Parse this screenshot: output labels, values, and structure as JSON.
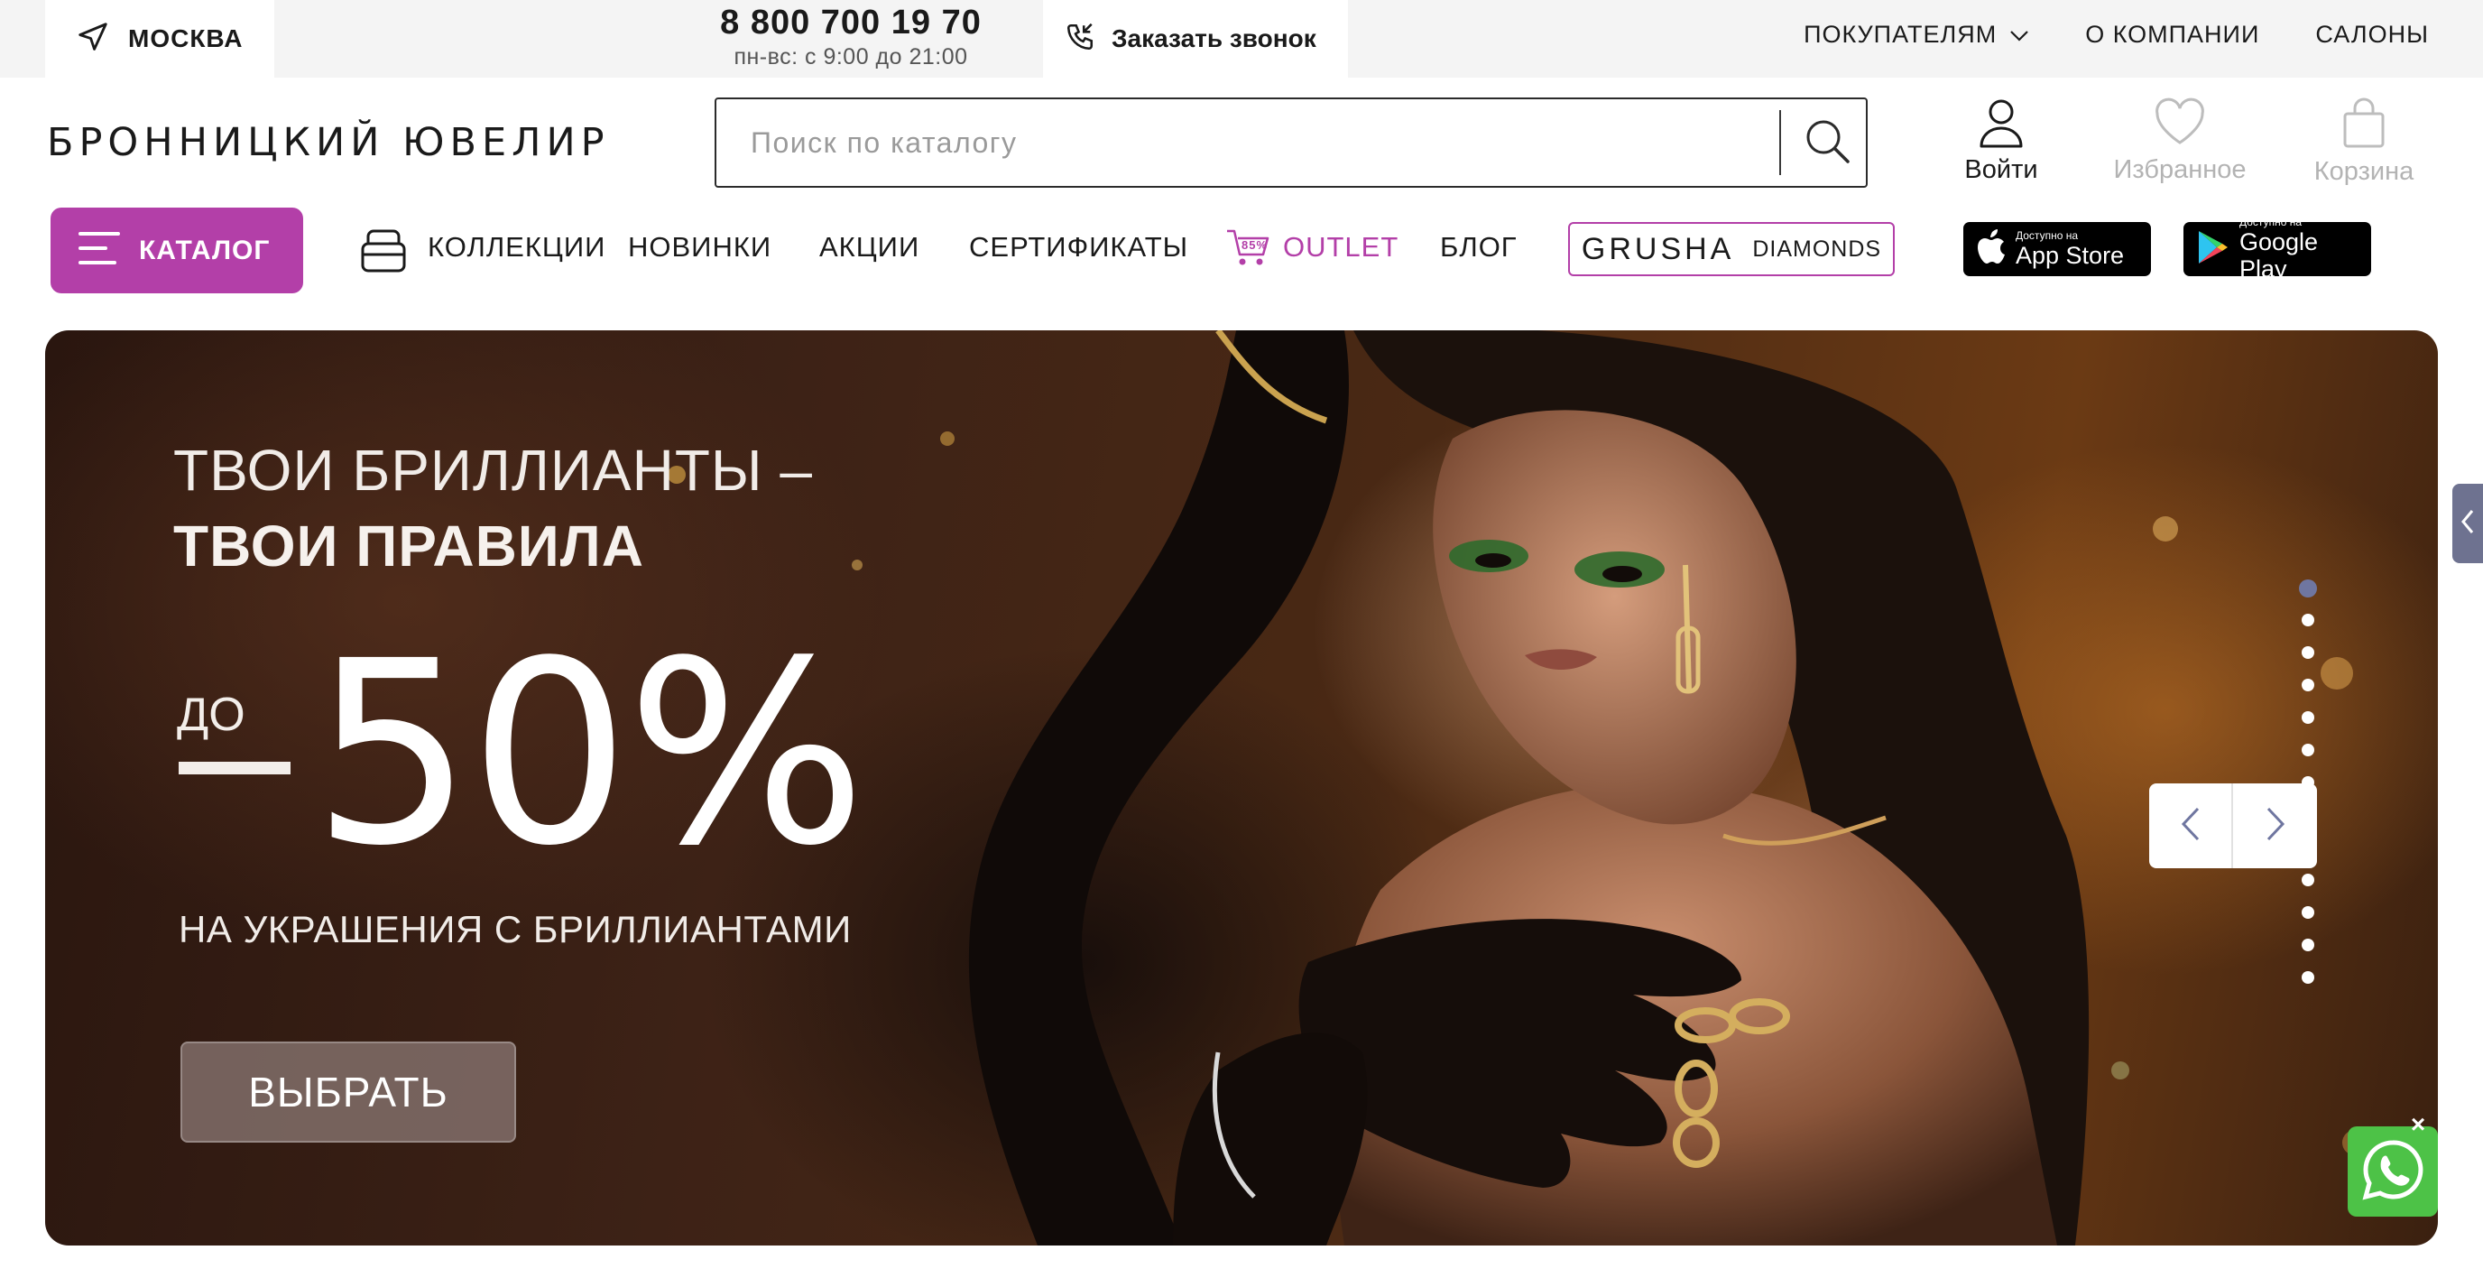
{
  "topbar": {
    "city": "МОСКВА",
    "phone": "8 800 700 19 70",
    "hours": "пн-вс: с 9:00 до 21:00",
    "callback": "Заказать звонок",
    "nav": [
      "ПОКУПАТЕЛЯМ",
      "О КОМПАНИИ",
      "САЛОНЫ"
    ]
  },
  "header": {
    "logo": "БРОННИЦКИЙ ЮВЕЛИР",
    "search_placeholder": "Поиск по каталогу",
    "login": "Войти",
    "favorites": "Избранное",
    "cart": "Корзина"
  },
  "nav": {
    "catalog": "КАТАЛОГ",
    "collections": "КОЛЛЕКЦИИ",
    "new": "НОВИНКИ",
    "promos": "АКЦИИ",
    "certificates": "СЕРТИФИКАТЫ",
    "outlet_badge": "85%",
    "outlet": "OUTLET",
    "blog": "БЛОГ",
    "grusha_1": "GRUSHA",
    "grusha_2": "DIAMONDS",
    "appstore_small": "Доступно на",
    "appstore_big": "App Store",
    "googleplay_small": "Доступно на",
    "googleplay_big": "Google Play"
  },
  "hero": {
    "line1": "ТВОИ БРИЛЛИАНТЫ –",
    "line2": "ТВОИ ПРАВИЛА",
    "prefix": "ДО",
    "discount": "50%",
    "subtitle": "НА УКРАШЕНИЯ С БРИЛЛИАНТАМИ",
    "button": "ВЫБРАТЬ",
    "slide_count": 13,
    "active_slide": 1
  },
  "colors": {
    "accent": "#b33fa8",
    "whatsapp": "#4dc247",
    "active_dot": "#6f76a0"
  }
}
